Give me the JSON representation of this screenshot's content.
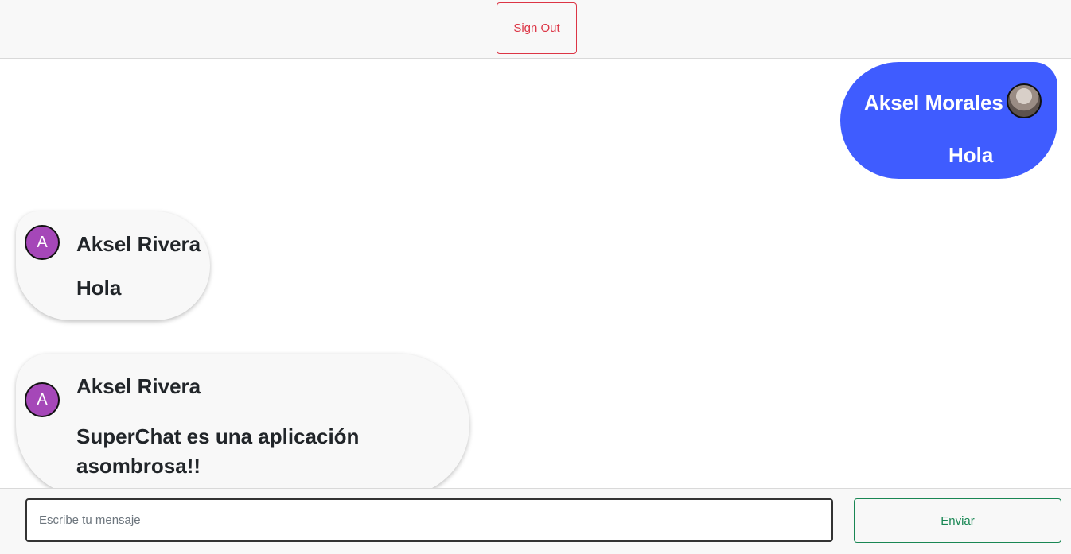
{
  "header": {
    "signout_label": "Sign Out"
  },
  "messages": [
    {
      "author": "Aksel Morales",
      "text": "Hola",
      "direction": "sent",
      "avatar": "photo"
    },
    {
      "author": "Aksel Rivera",
      "text": "Hola",
      "direction": "received",
      "avatar_letter": "A"
    },
    {
      "author": "Aksel Rivera",
      "text": "SuperChat es una aplicación asombrosa!!",
      "direction": "received",
      "avatar_letter": "A"
    }
  ],
  "composer": {
    "placeholder": "Escribe tu mensaje",
    "value": "",
    "send_label": "Enviar"
  },
  "colors": {
    "sent_bubble": "#3f5cff",
    "received_bubble": "#f8f8f8",
    "avatar_letter_bg": "#a547b8",
    "signout": "#dc3545",
    "send": "#198754"
  }
}
